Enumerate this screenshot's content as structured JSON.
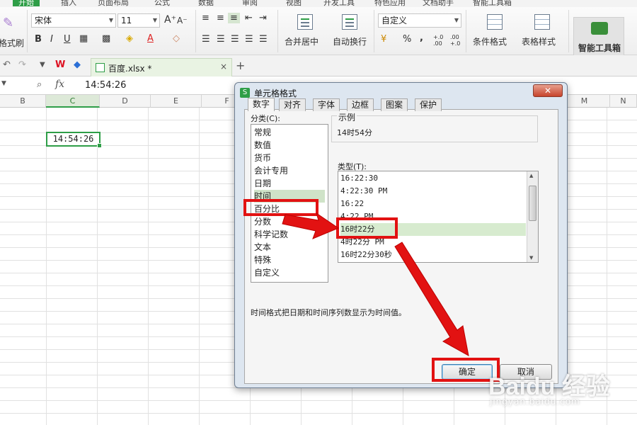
{
  "ribbon": {
    "tabs": [
      "开始",
      "插入",
      "页面布局",
      "公式",
      "数据",
      "审阅",
      "视图",
      "开发工具",
      "特色应用",
      "文档助手",
      "智能工具箱"
    ],
    "font_name": "宋体",
    "font_size": "11",
    "number_format": "自定义",
    "format_painter_label": "格式刷",
    "merge_center_label": "合并居中",
    "wrap_text_label": "自动换行",
    "conditional_format_label": "条件格式",
    "table_style_label": "表格样式",
    "smart_toolbox_label": "智能工具箱",
    "percent_symbol": "%",
    "comma_symbol": ",",
    "bold": "B",
    "italic": "I",
    "underline": "U",
    "font_color_letter": "A",
    "increase_font": "A⁺",
    "decrease_font": "A⁻",
    "dec_more": "+.0 .00",
    "dec_less": ".00 +.0"
  },
  "doc_tab": {
    "filename": "百度.xlsx *",
    "close": "×",
    "new_tab": "+"
  },
  "formula_bar": {
    "fx": "fx",
    "value": "14:54:26"
  },
  "columns": [
    "B",
    "C",
    "D",
    "E",
    "F",
    "M",
    "N"
  ],
  "cell": {
    "value": "14:54:26"
  },
  "dialog": {
    "title": "单元格格式",
    "tabs": [
      "数字",
      "对齐",
      "字体",
      "边框",
      "图案",
      "保护"
    ],
    "category_label": "分类(C):",
    "categories": [
      "常规",
      "数值",
      "货币",
      "会计专用",
      "日期",
      "时间",
      "百分比",
      "分数",
      "科学记数",
      "文本",
      "特殊",
      "自定义"
    ],
    "sample_label": "示例",
    "sample_value": "14时54分",
    "type_label": "类型(T):",
    "types": [
      "16:22:30",
      "4:22:30 PM",
      "16:22",
      "4:22 PM",
      "16时22分",
      "4时22分 PM",
      "16时22分30秒"
    ],
    "description": "时间格式把日期和时间序列数显示为时间值。",
    "ok": "确定",
    "cancel": "取消"
  },
  "watermark": {
    "main": "Baidu 经验",
    "sub": "jingyan.baidu.com"
  },
  "colors": {
    "accent_green": "#2e9e47",
    "annotation_red": "#e21212",
    "dialog_bg": "#dde6f0"
  }
}
